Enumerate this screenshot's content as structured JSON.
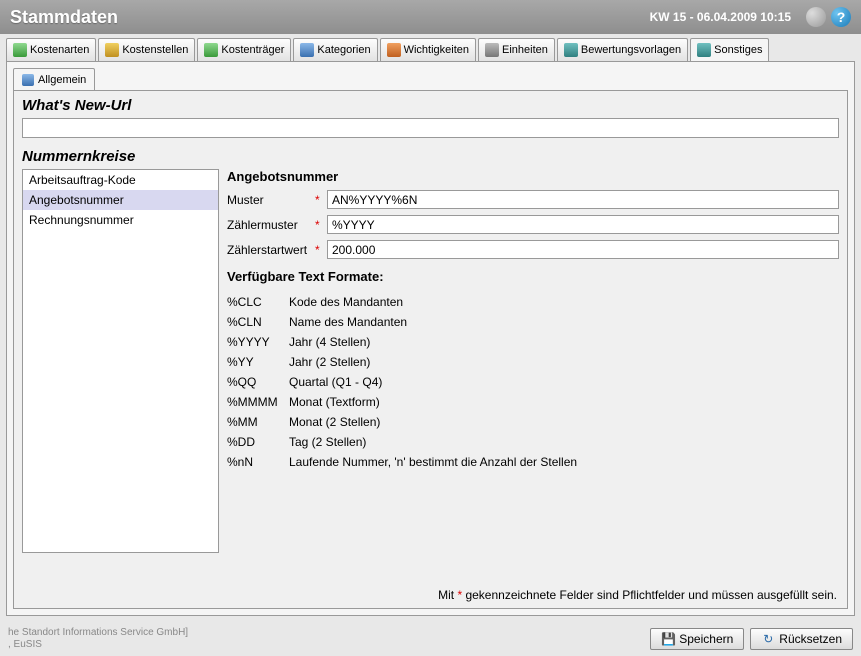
{
  "header": {
    "title": "Stammdaten",
    "date_info": "KW 15 - 06.04.2009 10:15"
  },
  "main_tabs": [
    {
      "label": "Kostenarten"
    },
    {
      "label": "Kostenstellen"
    },
    {
      "label": "Kostenträger"
    },
    {
      "label": "Kategorien"
    },
    {
      "label": "Wichtigkeiten"
    },
    {
      "label": "Einheiten"
    },
    {
      "label": "Bewertungsvorlagen"
    },
    {
      "label": "Sonstiges"
    }
  ],
  "sub_tabs": [
    {
      "label": "Allgemein"
    }
  ],
  "whats_new": {
    "title": "What's New-Url",
    "value": ""
  },
  "num_ranges": {
    "title": "Nummernkreise",
    "items": [
      {
        "label": "Arbeitsauftrag-Kode"
      },
      {
        "label": "Angebotsnummer"
      },
      {
        "label": "Rechnungsnummer"
      }
    ],
    "selected_index": 1
  },
  "detail": {
    "title": "Angebotsnummer",
    "fields": {
      "muster_label": "Muster",
      "muster_value": "AN%YYYY%6N",
      "zaehlermuster_label": "Zählermuster",
      "zaehlermuster_value": "%YYYY",
      "zaehlerstartwert_label": "Zählerstartwert",
      "zaehlerstartwert_value": "200.000"
    }
  },
  "formats": {
    "title": "Verfügbare Text Formate:",
    "rows": [
      {
        "code": "%CLC",
        "desc": "Kode des Mandanten"
      },
      {
        "code": "%CLN",
        "desc": "Name des Mandanten"
      },
      {
        "code": "%YYYY",
        "desc": "Jahr (4 Stellen)"
      },
      {
        "code": "%YY",
        "desc": "Jahr (2 Stellen)"
      },
      {
        "code": "%QQ",
        "desc": "Quartal (Q1 - Q4)"
      },
      {
        "code": "%MMMM",
        "desc": "Monat (Textform)"
      },
      {
        "code": "%MM",
        "desc": "Monat (2 Stellen)"
      },
      {
        "code": "%DD",
        "desc": "Tag (2 Stellen)"
      },
      {
        "code": "%nN",
        "desc": "Laufende Nummer, 'n' bestimmt die Anzahl der Stellen"
      }
    ]
  },
  "footer_note": {
    "prefix": "Mit ",
    "star": "*",
    "suffix": " gekennzeichnete Felder sind Pflichtfelder und müssen ausgefüllt sein."
  },
  "footer": {
    "company_line1": "he Standort Informations Service GmbH]",
    "company_line2": ", EuSIS",
    "save_label": "Speichern",
    "reset_label": "Rücksetzen"
  }
}
